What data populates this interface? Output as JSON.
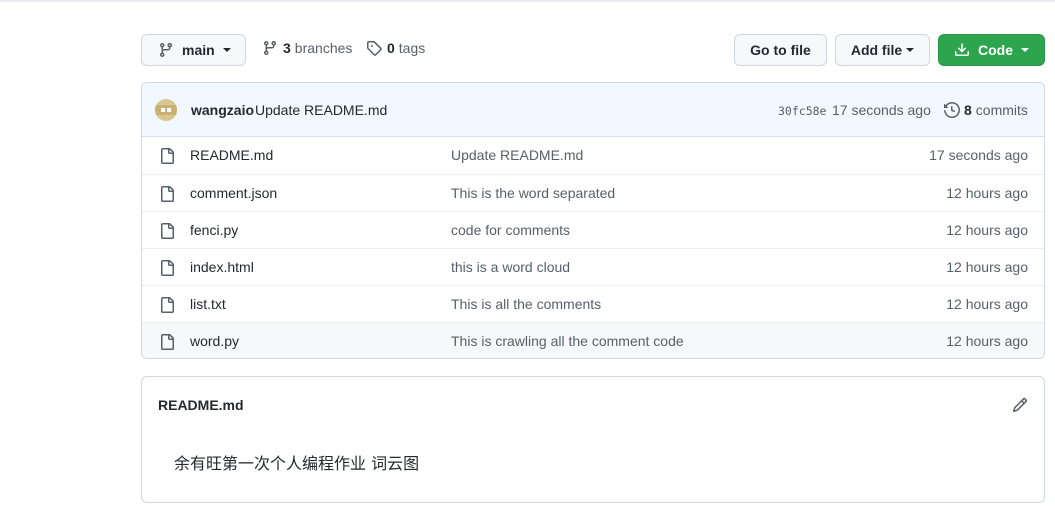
{
  "branch": {
    "name": "main"
  },
  "stats": {
    "branches_count": "3",
    "branches_label": "branches",
    "tags_count": "0",
    "tags_label": "tags"
  },
  "actions": {
    "go_to_file": "Go to file",
    "add_file": "Add file",
    "code": "Code"
  },
  "latest_commit": {
    "author": "wangzaio",
    "message": "Update README.md",
    "sha": "30fc58e",
    "time": "17 seconds ago",
    "commits_count": "8",
    "commits_label": "commits"
  },
  "files": [
    {
      "name": "README.md",
      "message": "Update README.md",
      "time": "17 seconds ago"
    },
    {
      "name": "comment.json",
      "message": "This is the word separated",
      "time": "12 hours ago"
    },
    {
      "name": "fenci.py",
      "message": "code for comments",
      "time": "12 hours ago"
    },
    {
      "name": "index.html",
      "message": "this is a word cloud",
      "time": "12 hours ago"
    },
    {
      "name": "list.txt",
      "message": "This is all the comments",
      "time": "12 hours ago"
    },
    {
      "name": "word.py",
      "message": "This is crawling all the comment code",
      "time": "12 hours ago"
    }
  ],
  "readme": {
    "title": "README.md",
    "content": "余有旺第一次个人编程作业 词云图"
  },
  "colors": {
    "accent_green": "#2da44e",
    "commit_header_bg": "#f1f8ff",
    "muted_text": "#57606a"
  },
  "icons": {
    "branch": "git-branch-icon",
    "tag": "tag-icon",
    "download": "download-icon",
    "history": "history-icon",
    "file": "file-icon",
    "edit": "pencil-icon"
  }
}
